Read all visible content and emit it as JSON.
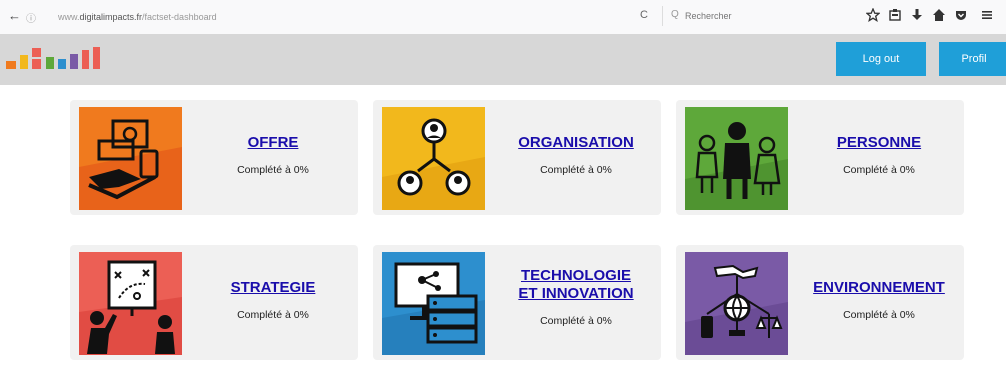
{
  "browser": {
    "url_prefix": "www.",
    "url_domain": "digitalimpacts.fr",
    "url_path": "/factset-dashboard",
    "search_placeholder": "Rechercher",
    "back_glyph": "←",
    "info_glyph": "ⓘ",
    "reload_glyph": "C",
    "search_glyph": "Q"
  },
  "header": {
    "logout_label": "Log out",
    "profil_label": "Profil",
    "accent": "#1f9fd8",
    "background": "#d7d7d7"
  },
  "cards": [
    {
      "title": "OFFRE",
      "status": "Complété à 0%",
      "icon": "money-hand-icon",
      "color": "#f07a1e"
    },
    {
      "title": "ORGANISATION",
      "status": "Complété à 0%",
      "icon": "org-chart-icon",
      "color": "#f2b81c"
    },
    {
      "title": "PERSONNE",
      "status": "Complété à 0%",
      "icon": "people-icon",
      "color": "#5ea83a"
    },
    {
      "title": "STRATEGIE",
      "status": "Complété à 0%",
      "icon": "strategy-board-icon",
      "color": "#ec5f55"
    },
    {
      "title_line1": "TECHNOLOGIE",
      "title_line2": "ET INNOVATION",
      "status": "Complété à 0%",
      "icon": "tech-servers-icon",
      "color": "#2d8fce"
    },
    {
      "title": "ENVIRONNEMENT",
      "status": "Complété à 0%",
      "icon": "environment-globe-icon",
      "color": "#7a5aa6"
    }
  ]
}
